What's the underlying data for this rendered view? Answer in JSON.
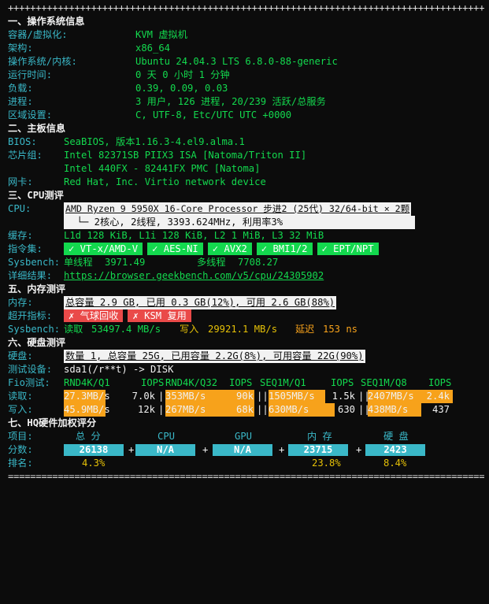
{
  "rule_top": "+++++++++++++++++++++++++++++++++++++++++++++++++++++++++++++++++++++++++++++++++++++++++++++++++",
  "rule_bottom": "=================================================================================================",
  "sec1": {
    "title": "一、操作系统信息",
    "rows": [
      {
        "label": "容器/虚拟化:",
        "value": "KVM 虚拟机"
      },
      {
        "label": "架构:",
        "value": "x86_64"
      },
      {
        "label": "操作系统/内核:",
        "value": "Ubuntu 24.04.3 LTS 6.8.0-88-generic"
      },
      {
        "label": "运行时间:",
        "value": "0 天 0 小时 1 分钟"
      },
      {
        "label": "负载:",
        "value": "0.39, 0.09, 0.03"
      },
      {
        "label": "进程:",
        "value": "3 用户, 126 进程, 20/239 活跃/总服务"
      },
      {
        "label": "区域设置:",
        "value": "C, UTF-8, Etc/UTC UTC +0000"
      }
    ]
  },
  "sec2": {
    "title": "二、主板信息",
    "bios_label": "BIOS:",
    "bios_value": "SeaBIOS, 版本1.16.3-4.el9.alma.1",
    "chip_label": "芯片组:",
    "chip_value1": "Intel 82371SB PIIX3 ISA [Natoma/Triton II]",
    "chip_value2": "Intel 440FX - 82441FX PMC [Natoma]",
    "nic_label": "网卡:",
    "nic_value": "Red Hat, Inc. Virtio network device"
  },
  "sec3": {
    "title": "三、CPU测评",
    "cpu_label": "CPU:",
    "cpu_line1": "AMD Ryzen 9 5950X 16-Core Processor 步进2 (25代) 32/64-bit × 2颗",
    "cpu_line2": "  └─ 2核心, 2线程, 3393.624MHz, 利用率3%",
    "cache_label": "缓存:",
    "cache_value": "L1d 128 KiB, L1i 128 KiB, L2 1 MiB, L3 32 MiB",
    "isa_label": "指令集:",
    "isa": [
      "✓ VT-x/AMD-V",
      "✓ AES-NI",
      "✓ AVX2",
      "✓ BMI1/2",
      "✓ EPT/NPT"
    ],
    "sysbench_label": "Sysbench:",
    "single_label": "单线程",
    "single_value": "3971.49",
    "multi_label": "多线程",
    "multi_value": "7708.27",
    "detail_label": "详细结果:",
    "detail_link": "https://browser.geekbench.com/v5/cpu/24305902"
  },
  "sec5": {
    "title": "五、内存测评",
    "mem_label": "内存:",
    "mem_value": "总容量 2.9 GB, 已用 0.3 GB(12%), 可用 2.6 GB(88%)",
    "over_label": "超开指标:",
    "over_chips": [
      "✗ 气球回收",
      "✗ KSM 复用"
    ],
    "sys_label": "Sysbench:",
    "read_label": "读取",
    "read_value": "53497.4 MB/s",
    "write_label": "写入",
    "write_value": "29921.1 MB/s",
    "lat_label": "延迟",
    "lat_value": "153 ns"
  },
  "sec6": {
    "title": "六、硬盘测评",
    "disk_label": "硬盘:",
    "disk_value": "数量 1, 总容量 25G, 已用容量 2.2G(8%), 可用容量 22G(90%)",
    "dev_label": "测试设备:",
    "dev_value": "sda1(/r**t) -> DISK",
    "fio_label": "Fio测试:",
    "fio_headers": [
      "RND4K/Q1",
      "IOPS",
      "RND4K/Q32",
      "IOPS",
      "SEQ1M/Q1",
      "IOPS",
      "SEQ1M/Q8",
      "IOPS"
    ],
    "read_label": "读取:",
    "read": [
      "27.3MB/s",
      "7.0k",
      "353MB/s",
      "90k",
      "1505MB/s",
      "1.5k",
      "2407MB/s",
      "2.4k"
    ],
    "read_pct": [
      0.42,
      0.93,
      0.6,
      0.95
    ],
    "write_label": "写入:",
    "write": [
      "45.9MB/s",
      "12k",
      "267MB/s",
      "68k",
      "630MB/s",
      "630",
      "438MB/s",
      "437"
    ],
    "write_pct": [
      0.42,
      0.93,
      0.7,
      0.6
    ]
  },
  "sec7": {
    "title": "七、HQ硬件加权评分",
    "item_label": "项目:",
    "headers": [
      "总 分",
      "CPU",
      "GPU",
      "内 存",
      "硬 盘"
    ],
    "score_label": "分数:",
    "scores": [
      "26138",
      "N/A",
      "N/A",
      "23715",
      "2423"
    ],
    "plus": "+",
    "rank_label": "排名:",
    "ranks": [
      "4.3%",
      "",
      "",
      "23.8%",
      "8.4%"
    ]
  }
}
